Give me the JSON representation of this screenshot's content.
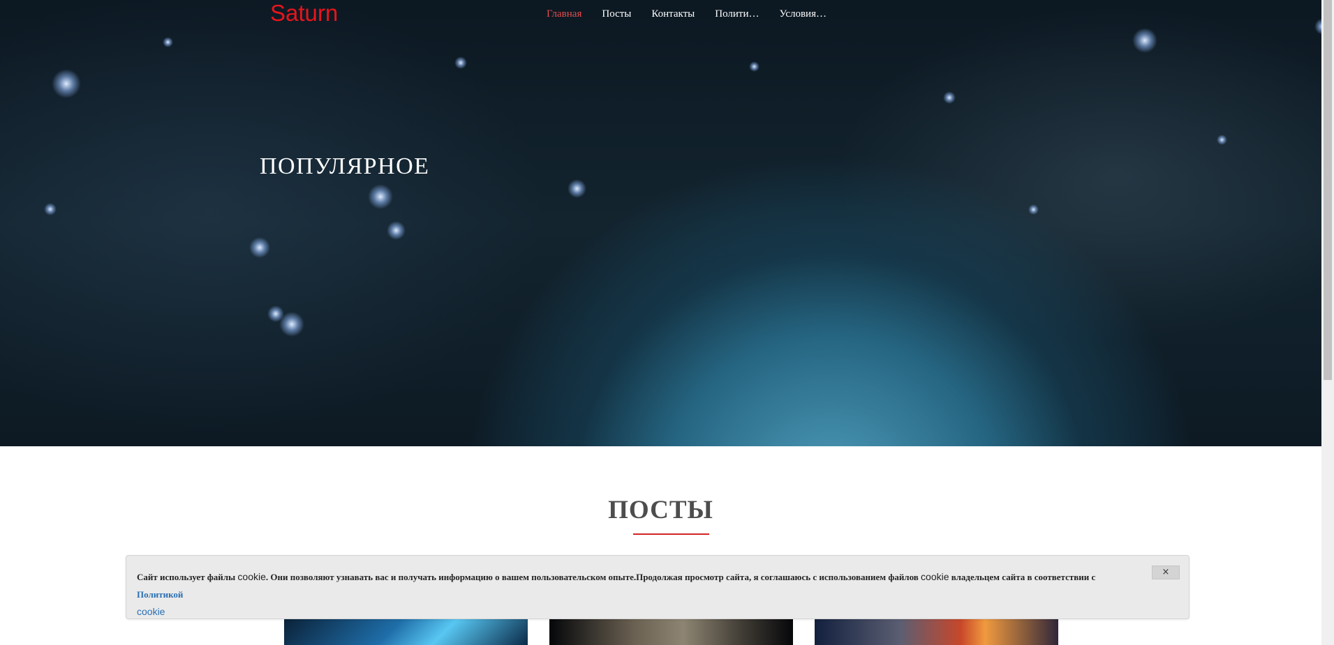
{
  "header": {
    "logo": "Saturn",
    "nav": [
      {
        "label": "Главная",
        "active": true
      },
      {
        "label": "Посты",
        "active": false
      },
      {
        "label": "Контакты",
        "active": false
      },
      {
        "label": "Полити…",
        "active": false
      },
      {
        "label": "Условия…",
        "active": false
      }
    ]
  },
  "hero": {
    "title": "ПОПУЛЯРНОЕ"
  },
  "posts": {
    "section_title": "ПОСТЫ"
  },
  "cookie_banner": {
    "text_1": "Сайт использует файлы ",
    "word_cookie_1": "cookie",
    "text_2": ". Они позволяют узнавать вас и получать информацию о вашем пользовательском опыте.Продолжая просмотр сайта, я соглашаюсь с использованием файлов ",
    "word_cookie_2": "cookie",
    "text_3": " владельцем сайта в соответствии с ",
    "link_label_1": "Политикой",
    "link_label_2": "cookie",
    "close_label": "×"
  },
  "colors": {
    "accent": "#e8141b",
    "nav_active": "#e74c4c",
    "link": "#2a6fb3",
    "rule": "#d22424"
  }
}
